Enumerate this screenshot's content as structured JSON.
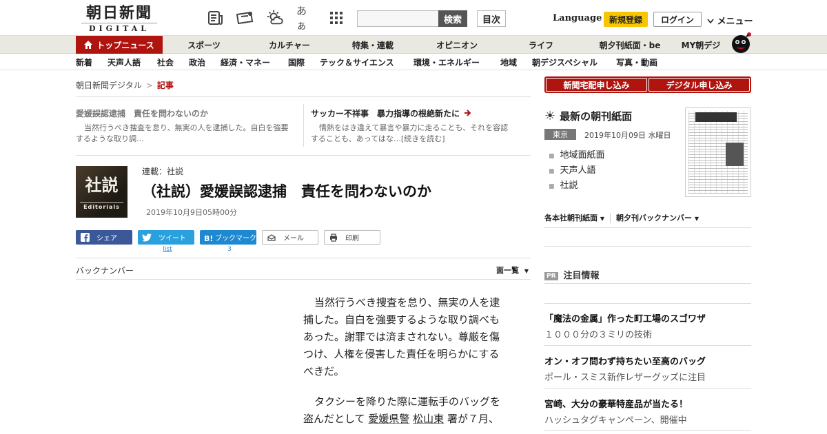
{
  "header": {
    "logo_main": "朝日新聞",
    "logo_sub": "DIGITAL",
    "font_size_icon_label": "あぁ",
    "search_button": "検索",
    "toc_button": "目次",
    "language": "Language",
    "register": "新規登録",
    "login": "ログイン",
    "menu": "メニュー"
  },
  "nav_main": [
    "トップニュース",
    "スポーツ",
    "カルチャー",
    "特集・連載",
    "オピニオン",
    "ライフ",
    "朝夕刊紙面・be",
    "MY朝デジ"
  ],
  "nav_sub": [
    "新着",
    "天声人語",
    "社会",
    "政治",
    "経済・マネー",
    "国際",
    "テック＆サイエンス",
    "環境・エネルギー",
    "地域",
    "朝デジスペシャル",
    "写真・動画"
  ],
  "breadcrumb": {
    "home": "朝日新聞デジタル",
    "sep": ">",
    "current": "記事"
  },
  "related": [
    {
      "title": "愛媛誤認逮捕　責任を問わないのか",
      "text": "当然行うべき捜査を怠り、無実の人を逮捕した。自白を強要するような取り調…"
    },
    {
      "title": "サッカー不祥事　暴力指導の根絶新たに",
      "text_1": "情熱をはき違えて暴言や暴力に走ることも、それを容認",
      "text_2": "することも、あってはな…[続きを読む]"
    }
  ],
  "article": {
    "thumb_kanji": "社説",
    "thumb_en": "Editorials",
    "series": "連載：社説",
    "title": "（社説）愛媛誤認逮捕　責任を問わないのか",
    "date": "2019年10月9日05時00分",
    "back_number": "バックナンバー",
    "list_all": "面一覧",
    "paragraph_1": [
      "当然行うべき捜査を怠り、無実の人を逮",
      "捕した。自白を強要するような取り調べも",
      "あった。謝罪では済まされない。尊厳を傷",
      "つけ、人権を侵害した責任を明らかにする",
      "べきだ。"
    ],
    "paragraph_2_line_1": "タクシーを降りた際に運転手のバッグを",
    "paragraph_2_line_2_a": "盗んだとして",
    "paragraph_2_police": "愛媛県警",
    "paragraph_2_station": "松山東",
    "paragraph_2_line_2_b": "署が７月、"
  },
  "share": {
    "facebook": "シェア",
    "twitter": "ツイート",
    "twitter_count": "list",
    "hatena": "ブックマーク",
    "hatena_count": "3",
    "mail": "メール",
    "print": "印刷"
  },
  "sidebar": {
    "subscribe_home": "新聞宅配申し込み",
    "subscribe_digital": "デジタル申し込み",
    "latest_paper": "最新の朝刊紙面",
    "region": "東京",
    "paper_date": "2019年10月09日 水曜日",
    "paper_links": [
      "地域面紙面",
      "天声人語",
      "社説"
    ],
    "back_links": [
      "各本社朝刊紙面",
      "朝夕刊バックナンバー"
    ],
    "pr_badge": "PR",
    "pr_heading": "注目情報",
    "ads": [
      {
        "title": "「魔法の金属」作った町工場のスゴワザ",
        "sub": "１０００分の３ミリの技術"
      },
      {
        "title": "オン・オフ問わず持ちたい至高のバッグ",
        "sub": "ポール・スミス新作レザーグッズに注目"
      },
      {
        "title": "宮崎、大分の豪華特産品が当たる！",
        "sub": "ハッシュタグキャンペーン、開催中"
      }
    ]
  },
  "colors": {
    "brand_red": "#b0140f",
    "register_yellow": "#f7c600",
    "facebook": "#3b5998",
    "twitter": "#2aa1de",
    "hatena": "#1e88d0"
  }
}
